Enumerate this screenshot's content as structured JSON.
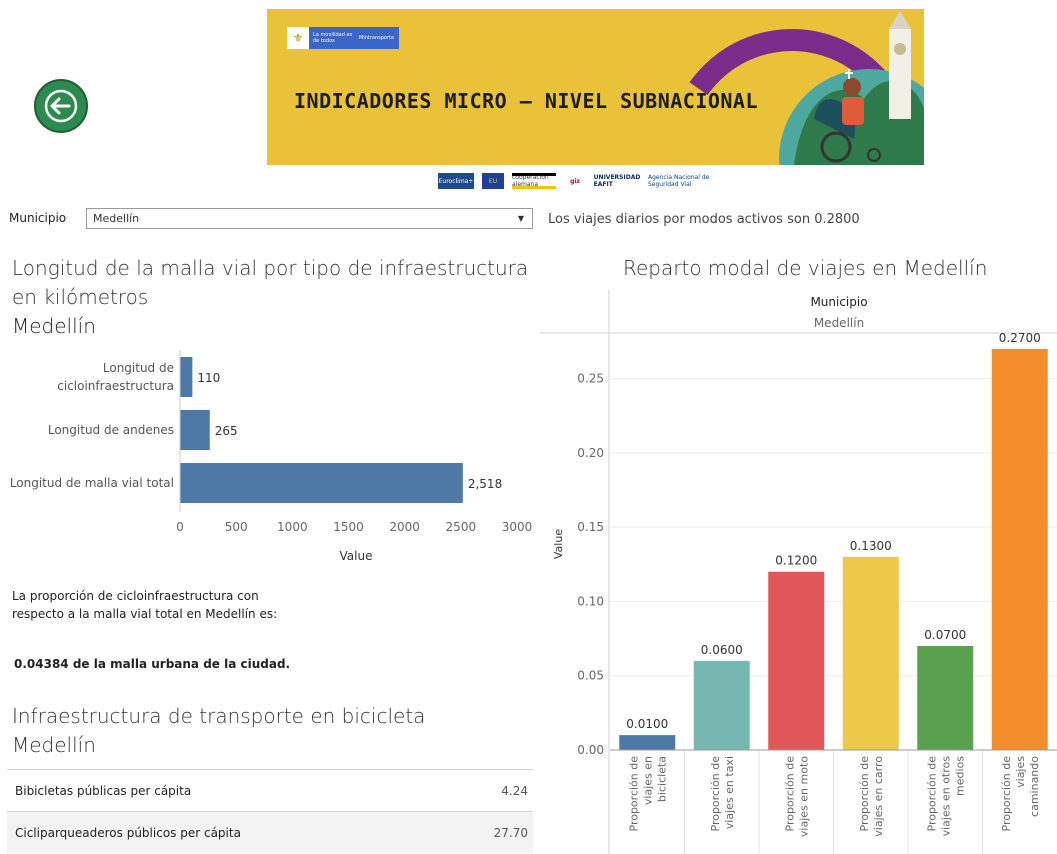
{
  "header": {
    "banner_title": "INDICADORES MICRO – NIVEL SUBNACIONAL",
    "gov_line1": "La movilidad es de todos",
    "gov_line2": "Mintransporte",
    "sponsor_logos": [
      "Euroclima+",
      "EU",
      "cooperación alemana",
      "giz",
      "UNIVERSIDAD EAFIT",
      "Agencia Nacional de Seguridad Vial"
    ]
  },
  "filter": {
    "label": "Municipio",
    "selected": "Medellín",
    "arrow": "▼"
  },
  "viajes_text": "Los viajes diarios por modos activos son 0.2800",
  "left_chart": {
    "title_line1": "Longitud de la malla vial por tipo de infraestructura",
    "title_line2": "en kilómetros",
    "subtitle": "Medellín"
  },
  "proportion": {
    "text": "La proporción de cicloinfraestructura con respecto a la malla vial total en Medellín es:",
    "value_text": "0.04384 de la malla urbana de la ciudad."
  },
  "bike_section": {
    "title": "Infraestructura de transporte en bicicleta",
    "subtitle": "Medellín",
    "rows": [
      {
        "label": "Bibicletas públicas per cápita",
        "value": "4.24"
      },
      {
        "label": "Cicliparqueaderos públicos per cápita",
        "value": "27.70"
      }
    ]
  },
  "right_chart_title": "Reparto modal de viajes en Medellín",
  "chart_data": [
    {
      "type": "bar",
      "orientation": "horizontal",
      "categories": [
        "Longitud de cicloinfraestructura",
        "Longitud de andenes",
        "Longitud de malla vial total"
      ],
      "category_lines": [
        [
          "Longitud de",
          "cicloinfraestructura"
        ],
        [
          "Longitud de andenes"
        ],
        [
          "Longitud de malla vial total"
        ]
      ],
      "values": [
        110,
        265,
        2518
      ],
      "value_labels": [
        "110",
        "265",
        "2,518"
      ],
      "xlabel": "Value",
      "xlim": [
        0,
        3000
      ],
      "ticks": [
        "0",
        "500",
        "1000",
        "1500",
        "2000",
        "2500",
        "3000"
      ],
      "tick_values": [
        0,
        500,
        1000,
        1500,
        2000,
        2500,
        3000
      ],
      "color": "#4e79a7"
    },
    {
      "type": "bar",
      "header": "Municipio",
      "header_value": "Medellín",
      "categories": [
        "Proporción de viajes en bicicleta",
        "Proporción de viajes en taxi",
        "Proporción de viajes en moto",
        "Proporción de viajes en carro",
        "Proporción de viajes en otros medios",
        "Proporción de viajes caminando"
      ],
      "category_lines": [
        [
          "Proporción de",
          "viajes en",
          "bicicleta"
        ],
        [
          "Proporción de",
          "viajes en taxi"
        ],
        [
          "Proporción de",
          "viajes en moto"
        ],
        [
          "Proporción de",
          "viajes en carro"
        ],
        [
          "Proporción de",
          "viajes en otros",
          "medios"
        ],
        [
          "Proporción de",
          "viajes",
          "caminando"
        ]
      ],
      "values": [
        0.01,
        0.06,
        0.12,
        0.13,
        0.07,
        0.27
      ],
      "value_labels": [
        "0.0100",
        "0.0600",
        "0.1200",
        "0.1300",
        "0.0700",
        "0.2700"
      ],
      "colors": [
        "#4e79a7",
        "#76b7b2",
        "#e15759",
        "#edc948",
        "#59a14f",
        "#f28e2b"
      ],
      "ylabel": "Value",
      "ylim": [
        0,
        0.28
      ],
      "ticks": [
        "0.00",
        "0.05",
        "0.10",
        "0.15",
        "0.20",
        "0.25"
      ],
      "tick_values": [
        0,
        0.05,
        0.1,
        0.15,
        0.2,
        0.25
      ]
    }
  ]
}
